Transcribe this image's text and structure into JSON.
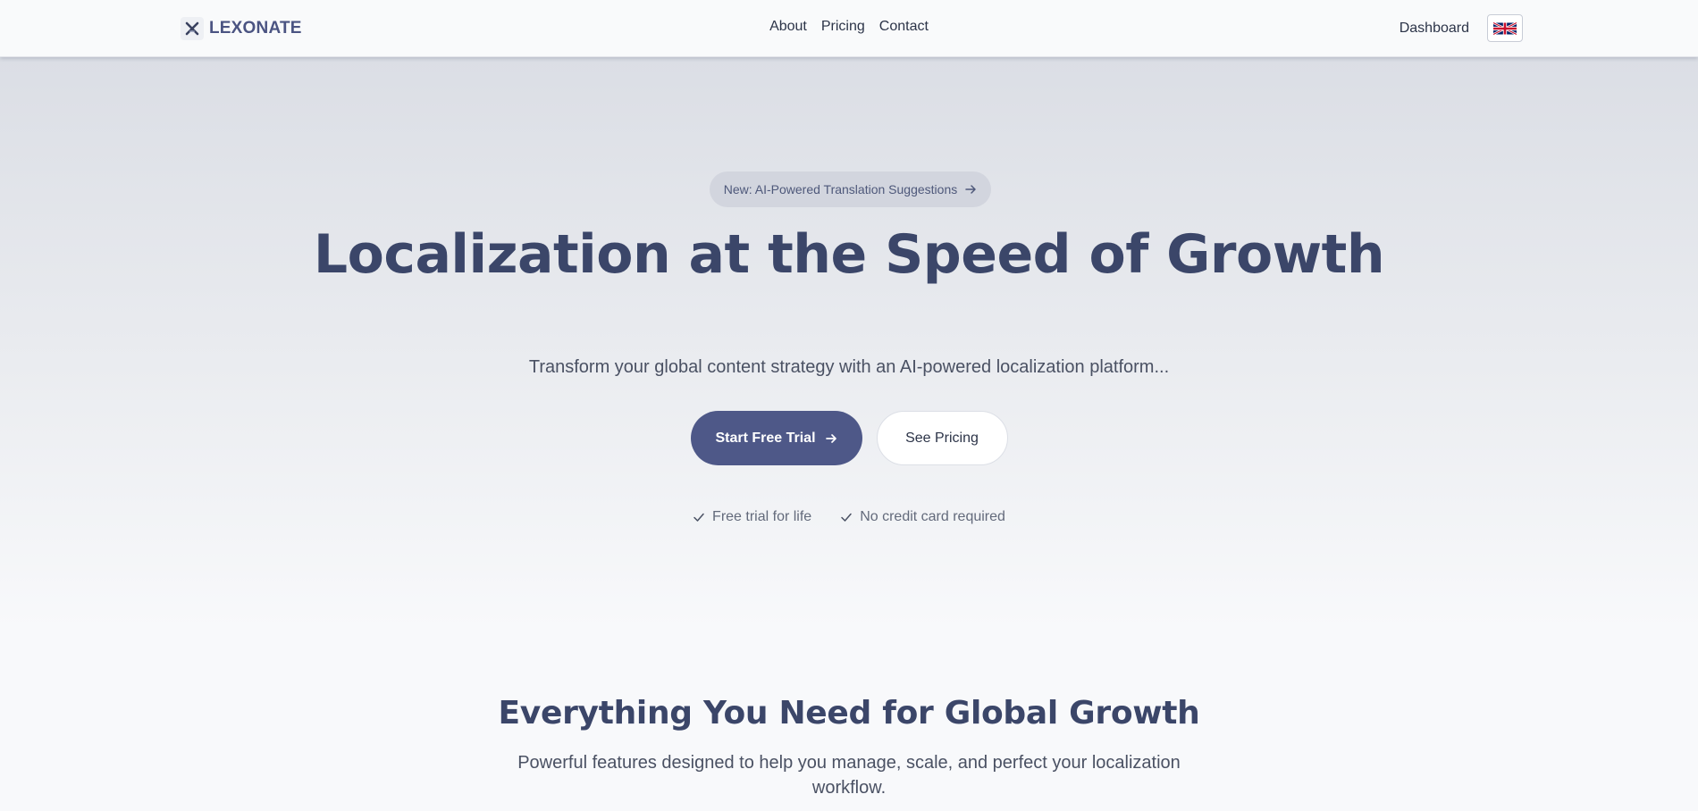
{
  "header": {
    "brand_name": "LEXONATE",
    "nav": [
      {
        "label": "About"
      },
      {
        "label": "Pricing"
      },
      {
        "label": "Contact"
      }
    ],
    "dashboard_label": "Dashboard",
    "language_icon": "uk-flag-icon"
  },
  "hero": {
    "announcement": "New: AI-Powered Translation Suggestions",
    "title": "Localization at the Speed of Growth",
    "subtitle": "Transform your global content strategy with an AI-powered localization platform...",
    "primary_cta": "Start Free Trial",
    "secondary_cta": "See Pricing",
    "checks": [
      {
        "label": "Free trial for life"
      },
      {
        "label": "No credit card required"
      }
    ]
  },
  "features": {
    "title": "Everything You Need for Global Growth",
    "subtitle": "Powerful features designed to help you manage, scale, and perfect your localization workflow."
  },
  "colors": {
    "accent": "#4e5888",
    "heading": "#3b4669",
    "background": "#f8f9fb"
  }
}
